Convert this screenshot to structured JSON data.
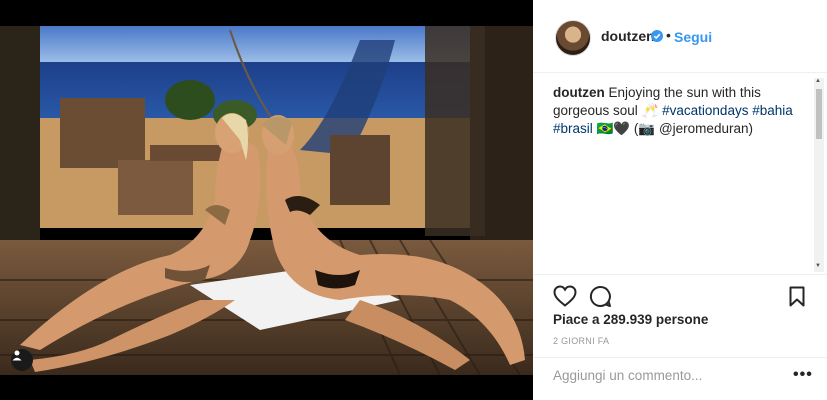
{
  "post": {
    "username": "doutzen",
    "follow_separator": "•",
    "follow_label": "Segui",
    "caption_user": "doutzen",
    "caption_text": "Enjoying the sun with this gorgeous soul 🥂",
    "hashtags": [
      "#vacationdays",
      "#bahia",
      "#brasil"
    ],
    "caption_tail": "🇧🇷🖤 (📷 @jeromeduran)",
    "likes_text": "Piace a 289.939 persone",
    "time_ago": "2 GIORNI FA",
    "comment_placeholder": "Aggiungi un commento...",
    "more_label": "•••"
  },
  "colors": {
    "link": "#3897f0",
    "hashtag": "#003569",
    "muted": "#999999"
  },
  "icons": [
    "user-tag-icon",
    "verified-badge-icon",
    "heart-icon",
    "comment-icon",
    "bookmark-icon"
  ]
}
